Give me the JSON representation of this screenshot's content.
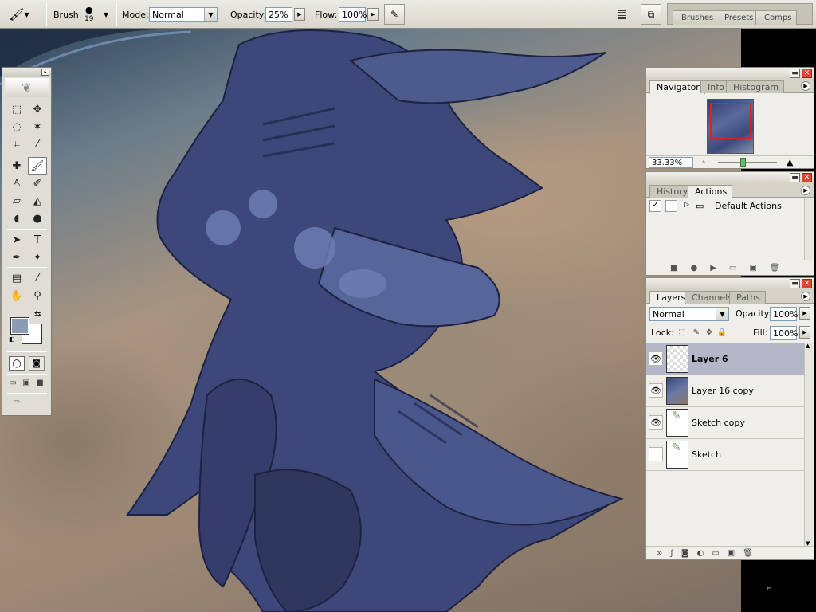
{
  "options_bar": {
    "brush_label": "Brush:",
    "brush_size": "19",
    "mode_label": "Mode:",
    "mode_value": "Normal",
    "opacity_label": "Opacity:",
    "opacity_value": "25%",
    "flow_label": "Flow:",
    "flow_value": "100%"
  },
  "palette_well": {
    "tabs": [
      {
        "label": "Brushes"
      },
      {
        "label": "Presets"
      },
      {
        "label": "Comps"
      }
    ]
  },
  "navigator_panel": {
    "tabs": [
      {
        "label": "Navigator"
      },
      {
        "label": "Info"
      },
      {
        "label": "Histogram"
      }
    ],
    "zoom": "33.33%"
  },
  "actions_panel": {
    "tabs": [
      {
        "label": "History"
      },
      {
        "label": "Actions"
      }
    ],
    "items": [
      {
        "label": "Default Actions"
      }
    ]
  },
  "layers_panel": {
    "tabs": [
      {
        "label": "Layers"
      },
      {
        "label": "Channels"
      },
      {
        "label": "Paths"
      }
    ],
    "blend_mode": "Normal",
    "opacity_label": "Opacity:",
    "opacity_value": "100%",
    "lock_label": "Lock:",
    "fill_label": "Fill:",
    "fill_value": "100%",
    "layers": [
      {
        "name": "Layer 6",
        "visible": true,
        "selected": true
      },
      {
        "name": "Layer 16 copy",
        "visible": true,
        "selected": false
      },
      {
        "name": "Sketch copy",
        "visible": true,
        "selected": false
      },
      {
        "name": "Sketch",
        "visible": false,
        "selected": false
      }
    ]
  },
  "colors": {
    "foreground": "#8b9bb3",
    "background": "#ffffff",
    "selected_layer": "#b4b7c8",
    "creature": "#3d4779"
  }
}
